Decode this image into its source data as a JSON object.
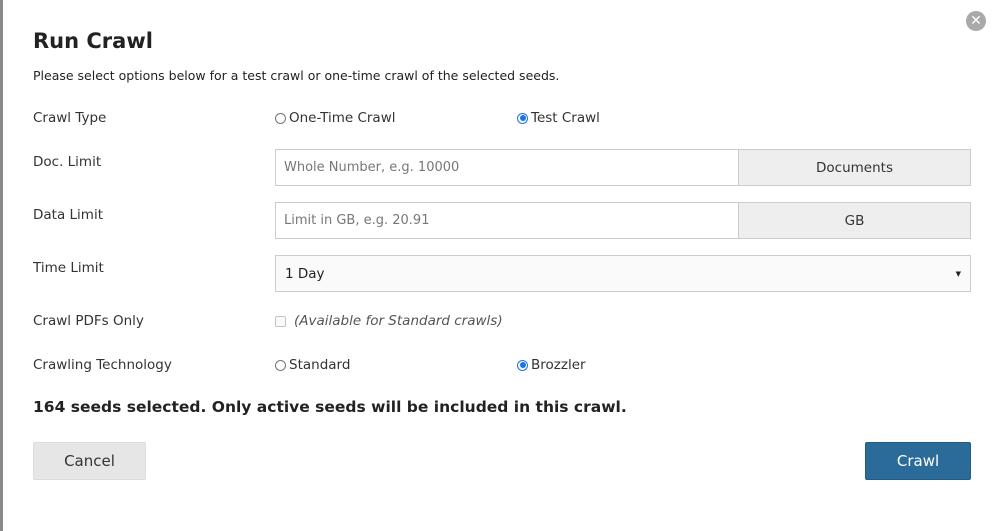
{
  "dialog": {
    "title": "Run Crawl",
    "subtitle": "Please select options below for a test crawl or one-time crawl of the selected seeds.",
    "close_icon": "close-circle-icon"
  },
  "crawl_type": {
    "label": "Crawl Type",
    "options": [
      {
        "label": "One-Time Crawl",
        "checked": false
      },
      {
        "label": "Test Crawl",
        "checked": true
      }
    ]
  },
  "doc_limit": {
    "label": "Doc. Limit",
    "value": "",
    "placeholder": "Whole Number, e.g. 10000",
    "unit": "Documents"
  },
  "data_limit": {
    "label": "Data Limit",
    "value": "",
    "placeholder": "Limit in GB, e.g. 20.91",
    "unit": "GB"
  },
  "time_limit": {
    "label": "Time Limit",
    "selected": "1 Day"
  },
  "pdfs_only": {
    "label": "Crawl PDFs Only",
    "checked": false,
    "note": "(Available for Standard crawls)"
  },
  "crawling_technology": {
    "label": "Crawling Technology",
    "options": [
      {
        "label": "Standard",
        "checked": false
      },
      {
        "label": "Brozzler",
        "checked": true
      }
    ]
  },
  "summary": "164 seeds selected. Only active seeds will be included in this crawl.",
  "actions": {
    "cancel": "Cancel",
    "crawl": "Crawl"
  },
  "colors": {
    "primary": "#2b6b9a",
    "radio_checked": "#1a73e8"
  }
}
